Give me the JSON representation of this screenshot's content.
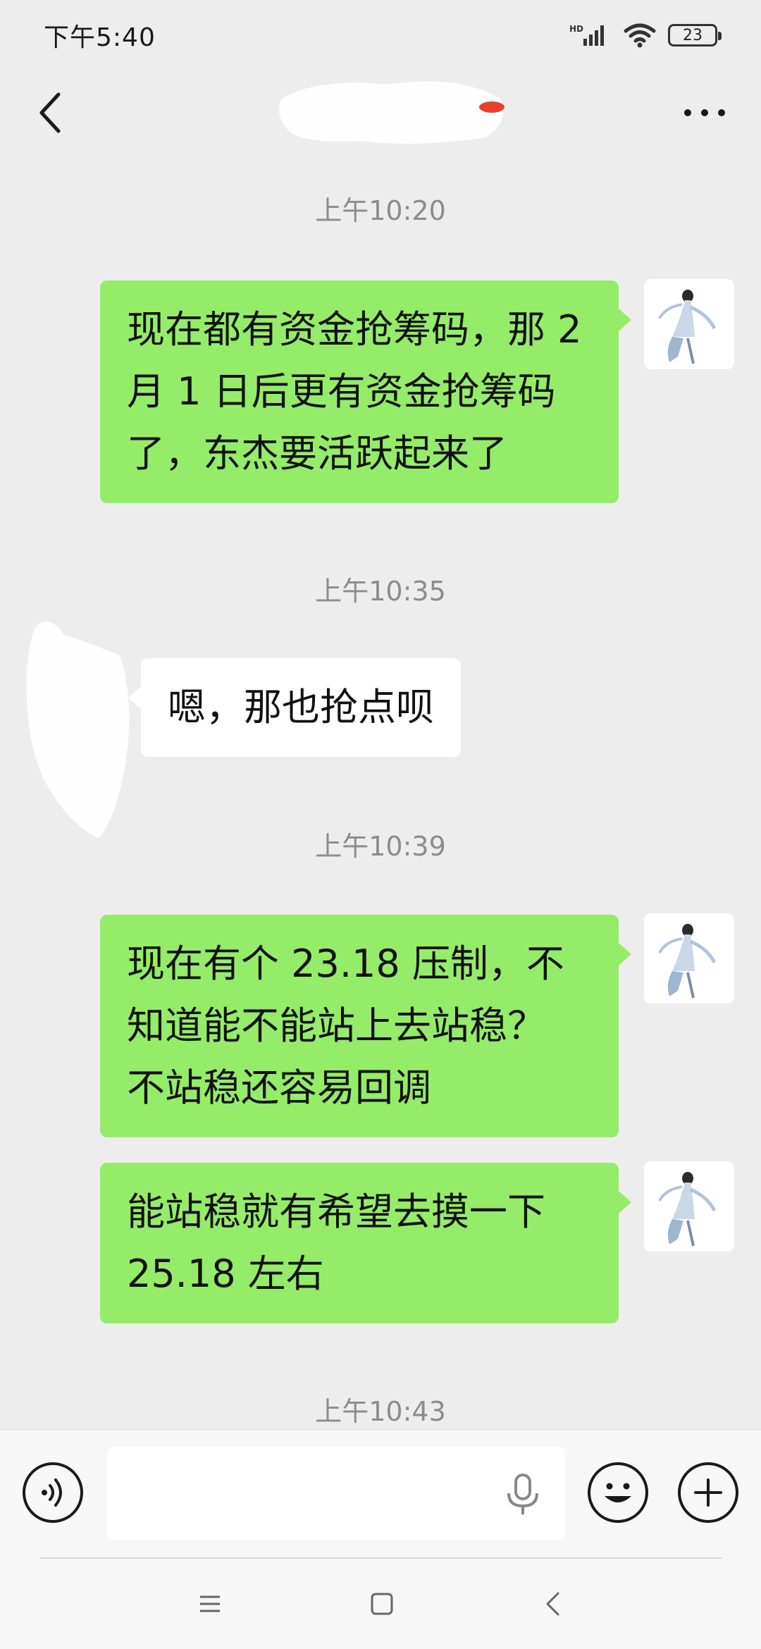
{
  "status_bar": {
    "time": "下午5:40",
    "network": "HD",
    "battery": "23"
  },
  "header": {
    "back_icon": "chevron-left-icon",
    "more_icon": "more-dots-icon"
  },
  "messages": [
    {
      "type": "timestamp",
      "text": "上午10:20"
    },
    {
      "type": "outgoing",
      "lines": [
        "现在都有资金抢筹码，那 2",
        "月 1 日后更有资金抢筹码",
        "了，东杰要活跃起来了"
      ]
    },
    {
      "type": "timestamp",
      "text": "上午10:35"
    },
    {
      "type": "incoming",
      "lines": [
        "嗯，那也抢点呗"
      ]
    },
    {
      "type": "timestamp",
      "text": "上午10:39"
    },
    {
      "type": "outgoing",
      "lines": [
        "现在有个 23.18 压制，不",
        "知道能不能站上去站稳？",
        "不站稳还容易回调"
      ]
    },
    {
      "type": "outgoing",
      "lines": [
        "能站稳就有希望去摸一下",
        "25.18 左右"
      ]
    },
    {
      "type": "timestamp",
      "text": "上午10:43"
    }
  ],
  "input_bar": {
    "voice_icon": "voice-icon",
    "input_value": "",
    "mic_icon": "mic-icon",
    "emoji_icon": "emoji-icon",
    "plus_icon": "plus-icon"
  },
  "nav_bar": {
    "menu_icon": "menu-icon",
    "home_icon": "home-icon",
    "back_icon": "back-icon"
  }
}
